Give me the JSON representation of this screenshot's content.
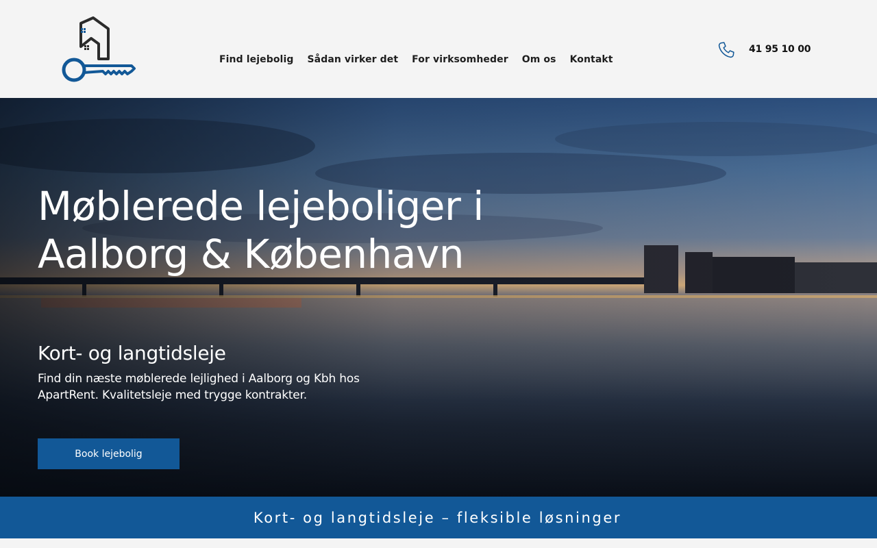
{
  "header": {
    "logo_icon": "house-key-icon",
    "nav": [
      {
        "label": "Find lejebolig"
      },
      {
        "label": "Sådan virker det"
      },
      {
        "label": "For virksomheder"
      },
      {
        "label": "Om os"
      },
      {
        "label": "Kontakt"
      }
    ],
    "phone_icon": "phone-icon",
    "phone": "41 95 10 00"
  },
  "hero": {
    "title_line1": "Møblerede lejeboliger i",
    "title_line2": "Aalborg & København",
    "subtitle": "Kort- og langtidsleje",
    "description": "Find din næste møblerede lejlighed i Aalborg og Kbh hos ApartRent. Kvalitetsleje med trygge kontrakter.",
    "button_label": "Book lejebolig"
  },
  "banner": {
    "text": "Kort- og langtidsleje – fleksible løsninger"
  },
  "colors": {
    "brand_blue": "#125897",
    "header_bg": "#f4f4f4",
    "text_dark": "#1e1e1e"
  }
}
